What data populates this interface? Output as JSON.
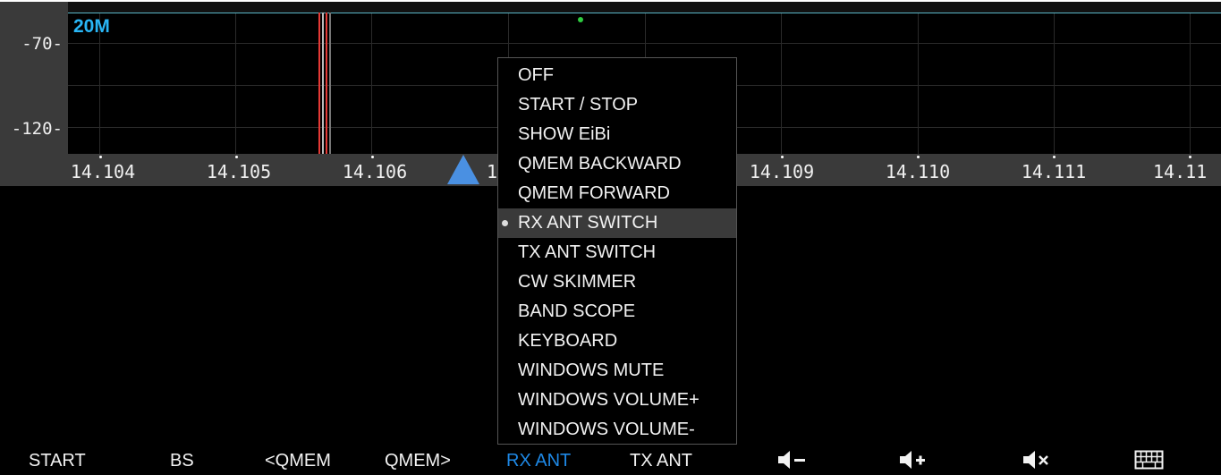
{
  "scope": {
    "band": "20M",
    "y_ticks": [
      "-70-",
      "-120-"
    ],
    "x_ticks": [
      "14.104",
      "14.105",
      "14.106",
      "14",
      "14.109",
      "14.110",
      "14.111",
      "14.11"
    ]
  },
  "menu": {
    "selected_index": 5,
    "items": [
      "OFF",
      "START / STOP",
      "SHOW EiBi",
      "QMEM BACKWARD",
      "QMEM FORWARD",
      "RX ANT SWITCH",
      "TX ANT SWITCH",
      "CW SKIMMER",
      "BAND SCOPE",
      "KEYBOARD",
      "WINDOWS MUTE",
      "WINDOWS VOLUME+",
      "WINDOWS VOLUME-"
    ]
  },
  "bottom_bar": {
    "buttons": [
      "START",
      "BS",
      "<QMEM",
      "QMEM>",
      "RX ANT",
      "TX ANT"
    ],
    "active": "RX ANT",
    "icons": [
      "volume-down-icon",
      "volume-up-icon",
      "volume-mute-icon",
      "keyboard-icon"
    ]
  },
  "colors": {
    "band_label": "#29b6f6",
    "active_button": "#1e88e5",
    "vfo_marker": "#4a90e2",
    "signal_marker": "#e53935"
  }
}
